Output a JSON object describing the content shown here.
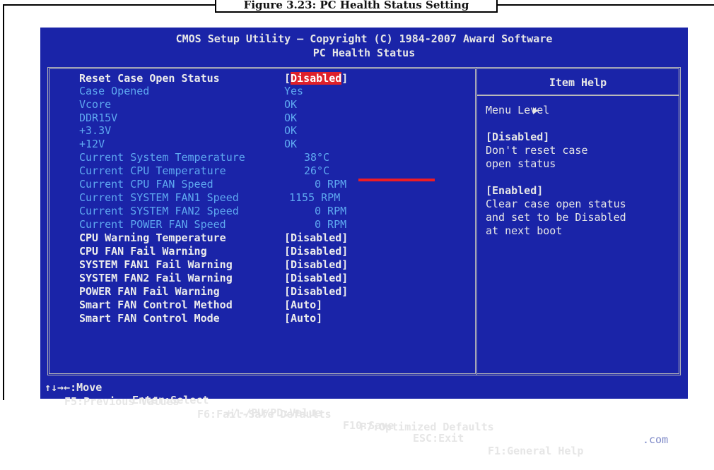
{
  "caption": "Figure 3.23: PC Health Status Setting",
  "header": {
    "line1": "CMOS Setup Utility – Copyright (C) 1984-2007 Award Software",
    "line2": "PC Health Status"
  },
  "settings": [
    {
      "label": "Reset Case Open Status",
      "value_open": "[",
      "value": "Disabled",
      "value_close": "]"
    },
    {
      "label": "Case Opened",
      "value": "Yes"
    },
    {
      "label": "Vcore",
      "value": "OK"
    },
    {
      "label": "DDR15V",
      "value": "OK"
    },
    {
      "label": "+3.3V",
      "value": "OK"
    },
    {
      "label": "+12V",
      "value": "OK"
    },
    {
      "label": "Current System Temperature",
      "value": "38°C"
    },
    {
      "label": "Current CPU Temperature",
      "value": "26°C"
    },
    {
      "label": "Current CPU FAN Speed",
      "value": "0 RPM"
    },
    {
      "label": "Current SYSTEM FAN1 Speed",
      "value": "1155 RPM"
    },
    {
      "label": "Current SYSTEM FAN2 Speed",
      "value": "0 RPM"
    },
    {
      "label": "Current POWER FAN Speed",
      "value": "0 RPM"
    },
    {
      "label": "CPU Warning Temperature",
      "value": "[Disabled]"
    },
    {
      "label": "CPU FAN Fail Warning",
      "value": "[Disabled]"
    },
    {
      "label": "SYSTEM FAN1 Fail Warning",
      "value": "[Disabled]"
    },
    {
      "label": "SYSTEM FAN2 Fail Warning",
      "value": "[Disabled]"
    },
    {
      "label": "POWER FAN Fail Warning",
      "value": "[Disabled]"
    },
    {
      "label": "Smart FAN Control Method",
      "value": "[Auto]"
    },
    {
      "label": "Smart FAN Control Mode",
      "value": "[Auto]"
    }
  ],
  "help": {
    "title": "Item Help",
    "menu_level": "Menu Level",
    "disabled_heading": "[Disabled]",
    "disabled_line1": "Don't reset case",
    "disabled_line2": "open status",
    "enabled_heading": "[Enabled]",
    "enabled_line1": "Clear case open status",
    "enabled_line2": "and set to be Disabled",
    "enabled_line3": "at next boot"
  },
  "footer": {
    "move": "↑↓→←:Move",
    "select": "Enter:Select",
    "value": "+/-/PU/PD:Value",
    "save": "F10:Save",
    "exit": "ESC:Exit",
    "help": "F1:General Help",
    "previous": "F5:Previous Values",
    "failsafe": "F6:Fail-Safe Defaults",
    "optimized": "F7:Optimized Defaults",
    "watermark": ".com"
  },
  "colors": {
    "background": "#1a24a8",
    "highlight": "#e0202a",
    "active_text": "#ececec",
    "readonly_text": "#5ea8f0"
  }
}
